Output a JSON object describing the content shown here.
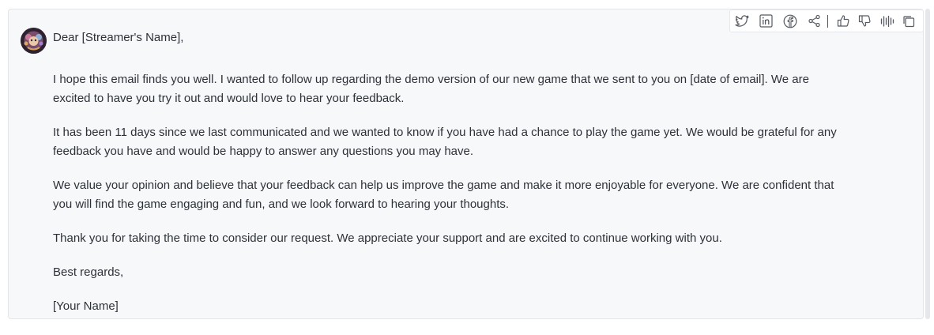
{
  "message": {
    "greeting": "Dear [Streamer's Name],",
    "paragraphs": [
      "I hope this email finds you well. I wanted to follow up regarding the demo version of our new game that we sent to you on [date of email]. We are excited to have you try it out and would love to hear your feedback.",
      "It has been 11 days since we last communicated and we wanted to know if you have had a chance to play the game yet. We would be grateful for any feedback you have and would be happy to answer any questions you may have.",
      "We value your opinion and believe that your feedback can help us improve the game and make it more enjoyable for everyone. We are confident that you will find the game engaging and fun, and we look forward to hearing your thoughts.",
      "Thank you for taking the time to consider our request. We appreciate your support and are excited to continue working with you."
    ],
    "closing": "Best regards,",
    "signature": "[Your Name]"
  },
  "toolbar": {
    "icons": [
      "twitter-icon",
      "linkedin-icon",
      "facebook-icon",
      "share-icon",
      "thumbs-up-icon",
      "thumbs-down-icon",
      "audio-wave-icon",
      "copy-icon"
    ]
  },
  "colors": {
    "card_background": "#f7f8fa",
    "text": "#2d3138",
    "icon": "#555a62",
    "divider_accent": "#1f6b4a"
  }
}
